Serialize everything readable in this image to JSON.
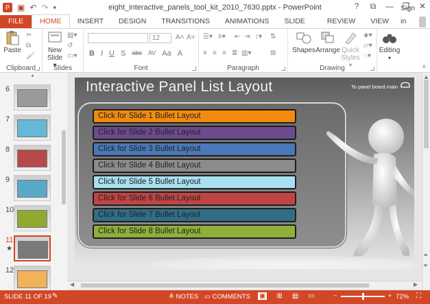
{
  "window": {
    "title": "eight_interactive_panels_tool_kit_2010_7630.pptx - PowerPoint",
    "controls": [
      "?",
      "⧉",
      "—",
      "❐",
      "✕"
    ]
  },
  "tabs": [
    {
      "label": "FILE"
    },
    {
      "label": "HOME",
      "active": true
    },
    {
      "label": "INSERT"
    },
    {
      "label": "DESIGN"
    },
    {
      "label": "TRANSITIONS"
    },
    {
      "label": "ANIMATIONS"
    },
    {
      "label": "SLIDE SHOW"
    },
    {
      "label": "REVIEW"
    },
    {
      "label": "VIEW"
    }
  ],
  "sign_in": "Sign in",
  "ribbon": {
    "clipboard": {
      "group": "Clipboard",
      "paste": "Paste"
    },
    "slides": {
      "group": "Slides",
      "new_slide_1": "New",
      "new_slide_2": "Slide ▾"
    },
    "font": {
      "group": "Font",
      "size": "12",
      "format_buttons": [
        "B",
        "I",
        "U",
        "S",
        "abc",
        "AV",
        "Aa",
        "A"
      ]
    },
    "paragraph": {
      "group": "Paragraph"
    },
    "drawing": {
      "group": "Drawing",
      "shapes": "Shapes",
      "arrange": "Arrange",
      "quick_styles_1": "Quick",
      "quick_styles_2": "Styles ▾"
    },
    "editing": {
      "group": "",
      "label": "Editing"
    }
  },
  "thumbnails": [
    {
      "num": "6",
      "color": "#9a9a9a"
    },
    {
      "num": "7",
      "color": "#67b8d8"
    },
    {
      "num": "8",
      "color": "#b64a4a"
    },
    {
      "num": "9",
      "color": "#5aa8c8"
    },
    {
      "num": "10",
      "color": "#8eaa2f"
    },
    {
      "num": "11",
      "color": "#7a7a7a",
      "selected": true,
      "star": "★"
    },
    {
      "num": "12",
      "color": "#f1b25b"
    }
  ],
  "slide": {
    "title": "Interactive Panel List Layout",
    "home_link": "To panel board main",
    "rows": [
      {
        "label": "Click for Slide 1 Bullet Layout",
        "color": "#f28a10"
      },
      {
        "label": "Click for Slide 2 Bullet Layout",
        "color": "#6c4a8e"
      },
      {
        "label": "Click for Slide 3 Bullet Layout",
        "color": "#4a78b8"
      },
      {
        "label": "Click for Slide 4 Bullet Layout",
        "color": "#8c8c8c"
      },
      {
        "label": "Click for Slide 5 Bullet Layout",
        "color": "#a9dff0"
      },
      {
        "label": "Click for Slide 6 Bullet Layout",
        "color": "#c04444"
      },
      {
        "label": "Click for Slide 7 Bullet Layout",
        "color": "#2f6e86"
      },
      {
        "label": "Click for Slide 8 Bullet Layout",
        "color": "#8eb03a"
      }
    ]
  },
  "status": {
    "slide_indicator": "SLIDE 11 OF 19",
    "notes": "≜ NOTES",
    "comments": "▭ COMMENTS",
    "zoom_minus": "−",
    "zoom_plus": "+",
    "zoom": "72%",
    "zoom_level": 0.72
  },
  "colors": {
    "accent": "#d24726"
  }
}
